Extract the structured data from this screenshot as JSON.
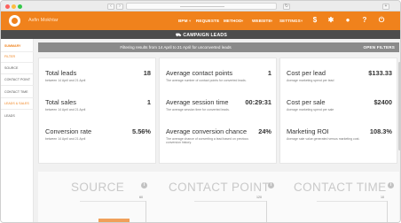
{
  "header": {
    "user_name": "Asfin Mokhtar",
    "nav": [
      "BPM",
      "REQUESTS",
      "METHOD",
      "WEBSITE",
      "SETTINGS"
    ],
    "icons": [
      "dollar-icon",
      "gear-icon",
      "user-icon",
      "help-icon",
      "power-icon"
    ]
  },
  "campaign_bar": {
    "title": "CAMPAIGN LEADS",
    "icon": "cart-icon"
  },
  "sidebar": {
    "items": [
      {
        "label": "SUMMARY",
        "state": "active"
      },
      {
        "label": "FILTER",
        "state": "orange"
      },
      {
        "label": "SOURCE",
        "state": ""
      },
      {
        "label": "CONTACT POINT",
        "state": ""
      },
      {
        "label": "CONTACT TIME",
        "state": ""
      },
      {
        "label": "LEADS & SALES",
        "state": "orange"
      },
      {
        "label": "LEADS",
        "state": ""
      }
    ]
  },
  "filter_bar": {
    "text": "Filtering results from 14 April to 21 April for unconverted leads",
    "button": "OPEN FILTERS"
  },
  "cards": [
    {
      "metrics": [
        {
          "label": "Total leads",
          "value": "18",
          "sub": "between 14 April and 21 April"
        },
        {
          "label": "Total sales",
          "value": "1",
          "sub": "between 14 April and 21 April"
        },
        {
          "label": "Conversion rate",
          "value": "5.56%",
          "sub": "between 14 April and 21 April"
        }
      ]
    },
    {
      "metrics": [
        {
          "label": "Average contact points",
          "value": "1",
          "sub": "The average number of contact points for converted leads."
        },
        {
          "label": "Average session time",
          "value": "00:29:31",
          "sub": "The average session time for converted leads."
        },
        {
          "label": "Average conversion chance",
          "value": "24%",
          "sub": "The average chance of converting a lead based on previous conversion history."
        }
      ]
    },
    {
      "metrics": [
        {
          "label": "Cost per lead",
          "value": "$133.33",
          "sub": "Average marketing spend per lead"
        },
        {
          "label": "Cost per sale",
          "value": "$2400",
          "sub": "Average marketing spend per sale"
        },
        {
          "label": "Marketing ROI",
          "value": "108.3%",
          "sub": "Average sale value generated versus marketing cost."
        }
      ]
    }
  ],
  "sections": [
    {
      "title": "SOURCE",
      "axis_top": "60"
    },
    {
      "title": "CONTACT POINT",
      "axis_top": "120"
    },
    {
      "title": "CONTACT TIME",
      "axis_top": "10"
    }
  ],
  "colors": {
    "accent": "#f0821c",
    "dark_bar": "#4c4c4c",
    "filter_bar": "#8a8a8a"
  }
}
